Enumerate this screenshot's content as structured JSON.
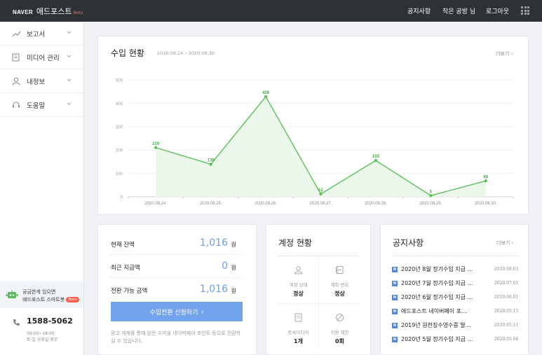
{
  "header": {
    "brand": "NAVER",
    "product": "애드포스트",
    "beta": "Beta",
    "nav": [
      "공지사항",
      "작은 공방 님",
      "로그아웃"
    ]
  },
  "sidebar": {
    "items": [
      {
        "label": "보고서",
        "icon": "chart-line-icon"
      },
      {
        "label": "미디어 관리",
        "icon": "document-icon"
      },
      {
        "label": "내정보",
        "icon": "user-icon"
      },
      {
        "label": "도움말",
        "icon": "headset-icon"
      }
    ],
    "chatbot_line1": "궁금한게 있으면",
    "chatbot_line2": "애드포스트 스마트봇",
    "chatbot_badge": "Beta",
    "phone": "1588-5062",
    "hours_line1": "09:00~18:00",
    "hours_line2": "토·일·공휴일 휴무"
  },
  "income": {
    "title": "수입 현황",
    "period": "2020.08.24.~2020.08.30.",
    "more": "더보기"
  },
  "chart_data": {
    "type": "line",
    "title": "",
    "categories": [
      "2020.08.24.",
      "2020.08.25.",
      "2020.08.26.",
      "2020.08.27.",
      "2020.08.28.",
      "2020.08.29.",
      "2020.08.30."
    ],
    "values": [
      210,
      139,
      428,
      12,
      155,
      5,
      68
    ],
    "ylim": [
      0,
      500
    ],
    "yticks": [
      0,
      100,
      200,
      300,
      400,
      500
    ],
    "grid": true,
    "color": "#5bc25b"
  },
  "balance": {
    "rows": [
      {
        "label": "현재 잔액",
        "value": "1,016",
        "unit": "원"
      },
      {
        "label": "최근 지급액",
        "value": "0",
        "unit": "원"
      },
      {
        "label": "전환 가능 금액",
        "value": "1,016",
        "unit": "원"
      }
    ],
    "button": "수입전환 신청하기",
    "note": "광고 게재를 통해 얻은 수익을 네이버페이 포인트 등으로 전환하실 수 있습니다."
  },
  "account": {
    "title": "계정 현황",
    "cells": [
      {
        "label": "계정 상태",
        "value": "정상",
        "icon": "person-icon"
      },
      {
        "label": "계좌 번호",
        "value": "정상",
        "icon": "bank-card-icon"
      },
      {
        "label": "등록미디어",
        "value": "1개",
        "icon": "media-doc-icon"
      },
      {
        "label": "이용 제한",
        "value": "0회",
        "icon": "restriction-icon"
      }
    ]
  },
  "notices": {
    "title": "공지사항",
    "more": "더보기",
    "items": [
      {
        "title": "2020년 8월 정기수입 지급 …",
        "date": "2020.08.03"
      },
      {
        "title": "2020년 7월 정기수입 지급 …",
        "date": "2020.07.01"
      },
      {
        "title": "2020년 6월 정기수입 지급 …",
        "date": "2020.06.01"
      },
      {
        "title": "애드포스트 네이버페이 포…",
        "date": "2020.05.15"
      },
      {
        "title": "2019년 원천징수영수증 발…",
        "date": "2020.05.11"
      },
      {
        "title": "2020년 5월 정기수입 지급 …",
        "date": "2020.05.04"
      }
    ],
    "icon_letter": "N"
  }
}
